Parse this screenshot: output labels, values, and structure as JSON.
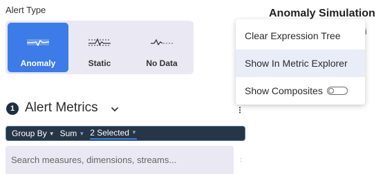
{
  "alert_type": {
    "label": "Alert Type",
    "options": [
      {
        "label": "Anomaly",
        "icon": "anomaly-icon",
        "selected": true
      },
      {
        "label": "Static",
        "icon": "static-threshold-icon",
        "selected": false
      },
      {
        "label": "No Data",
        "icon": "no-data-icon",
        "selected": false
      }
    ]
  },
  "metrics": {
    "step_number": "1",
    "title": "Alert Metrics",
    "query": {
      "group_by": "Group By",
      "aggregation": "Sum",
      "selection": "2 Selected"
    },
    "search_placeholder": "Search measures, dimensions, streams..."
  },
  "simulation": {
    "title": "Anomaly Simulation",
    "subtitle_fragment": "etri"
  },
  "context_menu": {
    "items": [
      {
        "label": "Clear Expression Tree"
      },
      {
        "label": "Show In Metric Explorer",
        "highlighted": true
      },
      {
        "label": "Show Composites",
        "toggle": false
      }
    ]
  },
  "colors": {
    "accent": "#3d7be8",
    "query_bar_bg": "#273647",
    "panel_bg": "#e9e8f3"
  }
}
